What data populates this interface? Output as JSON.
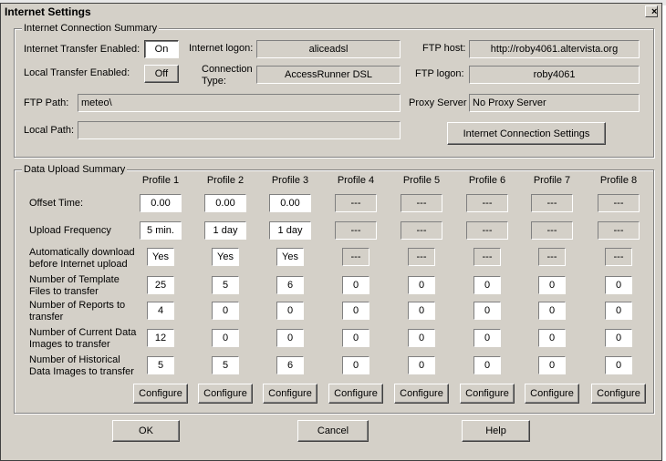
{
  "window": {
    "title": "Internet Settings",
    "close_label": "×"
  },
  "connection": {
    "group_title": "Internet Connection Summary",
    "transfer_label": "Internet Transfer Enabled:",
    "transfer_state": "On",
    "local_transfer_label": "Local Transfer Enabled:",
    "local_transfer_state": "Off",
    "logon_label": "Internet logon:",
    "logon_value": "aliceadsl",
    "conn_type_label_1": "Connection",
    "conn_type_label_2": "Type:",
    "conn_type_value": "AccessRunner DSL",
    "ftp_host_label": "FTP host:",
    "ftp_host_value": "http://roby4061.altervista.org",
    "ftp_logon_label": "FTP logon:",
    "ftp_logon_value": "roby4061",
    "ftp_path_label": "FTP Path:",
    "ftp_path_value": "meteo\\",
    "proxy_label": "Proxy Server",
    "proxy_value": "No Proxy Server",
    "local_path_label": "Local Path:",
    "local_path_value": "",
    "settings_button": "Internet Connection Settings"
  },
  "upload": {
    "group_title": "Data Upload Summary",
    "profiles": [
      "Profile 1",
      "Profile 2",
      "Profile 3",
      "Profile 4",
      "Profile 5",
      "Profile 6",
      "Profile 7",
      "Profile 8"
    ],
    "rows": [
      {
        "label": [
          "Offset Time:"
        ],
        "values": [
          "0.00",
          "0.00",
          "0.00",
          "---",
          "---",
          "---",
          "---",
          "---"
        ]
      },
      {
        "label": [
          "Upload Frequency"
        ],
        "values": [
          "5 min.",
          "1 day",
          "1 day",
          "---",
          "---",
          "---",
          "---",
          "---"
        ]
      },
      {
        "label": [
          "Automatically download",
          "before Internet upload"
        ],
        "values": [
          "Yes",
          "Yes",
          "Yes",
          "---",
          "---",
          "---",
          "---",
          "---"
        ]
      },
      {
        "label": [
          "Number of Template",
          "Files to transfer"
        ],
        "values": [
          "25",
          "5",
          "6",
          "0",
          "0",
          "0",
          "0",
          "0"
        ]
      },
      {
        "label": [
          "Number of Reports to",
          "transfer"
        ],
        "values": [
          "4",
          "0",
          "0",
          "0",
          "0",
          "0",
          "0",
          "0"
        ]
      },
      {
        "label": [
          "Number of Current Data",
          "Images to transfer"
        ],
        "values": [
          "12",
          "0",
          "0",
          "0",
          "0",
          "0",
          "0",
          "0"
        ]
      },
      {
        "label": [
          "Number of Historical",
          "Data Images to transfer"
        ],
        "values": [
          "5",
          "5",
          "6",
          "0",
          "0",
          "0",
          "0",
          "0"
        ]
      }
    ],
    "configure_label": "Configure"
  },
  "footer": {
    "ok": "OK",
    "cancel": "Cancel",
    "help": "Help"
  }
}
